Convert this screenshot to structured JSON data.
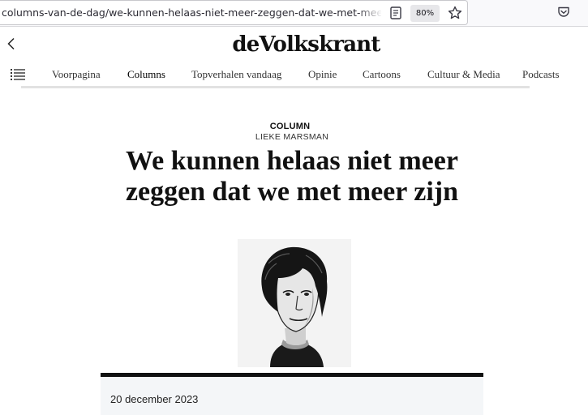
{
  "browser": {
    "url": "columns-van-de-dag/we-kunnen-helaas-niet-meer-zeggen-dat-we-met-meer-zijn~",
    "zoom": "80%",
    "icons": [
      "reader-view-icon",
      "bookmark-star-icon",
      "pocket-icon"
    ]
  },
  "site": {
    "logo": "deVolkskrant",
    "nav": [
      "Voorpagina",
      "Columns",
      "Topverhalen vandaag",
      "Opinie",
      "Cartoons",
      "Cultuur & Media",
      "Podcasts"
    ],
    "active_nav": "Columns"
  },
  "article": {
    "kicker": "COLUMN",
    "author": "LIEKE MARSMAN",
    "headline": "We kunnen helaas niet meer zeggen dat we met meer zijn",
    "date": "20 december 2023"
  }
}
